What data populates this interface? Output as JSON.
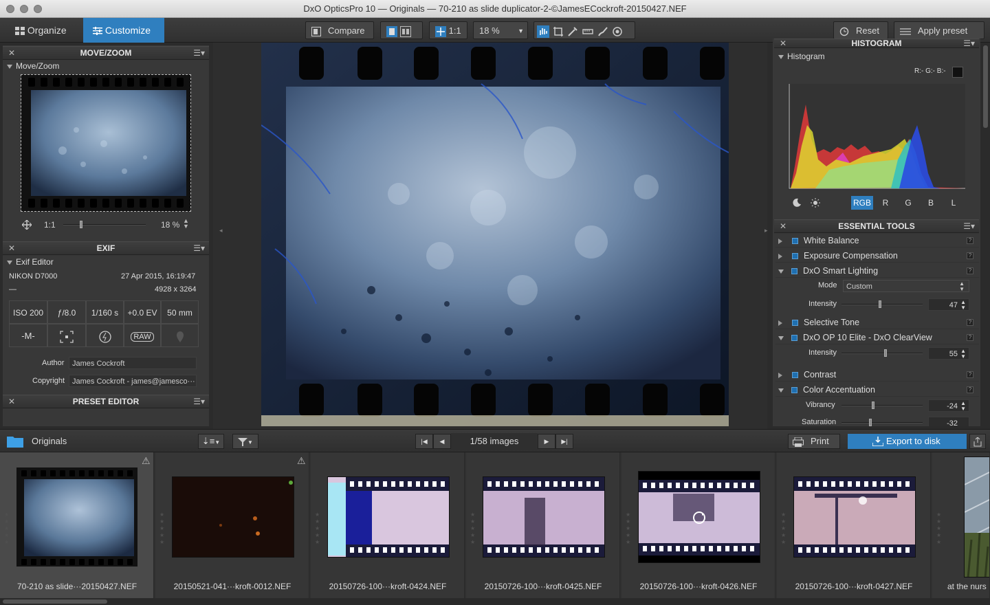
{
  "window": {
    "title": "DxO OpticsPro 10 — Originals — 70-210 as slide duplicator-2-©JamesECockroft-20150427.NEF"
  },
  "tabs": [
    {
      "label": "Organize"
    },
    {
      "label": "Customize"
    }
  ],
  "toolbar": {
    "compare_label": "Compare",
    "ratio_label": "1:1",
    "zoom_value": "18 %",
    "reset_label": "Reset",
    "apply_preset_label": "Apply preset"
  },
  "movezoom": {
    "header": "MOVE/ZOOM",
    "sub": "Move/Zoom",
    "ratio": "1:1",
    "zoom": "18 %"
  },
  "exif": {
    "header": "EXIF",
    "sub": "Exif Editor",
    "camera": "NIKON D7000",
    "date": "27 Apr 2015, 16:19:47",
    "lens": "—",
    "dimensions": "4928 x 3264",
    "iso": "ISO 200",
    "aperture": "ƒ/8.0",
    "shutter": "1/160 s",
    "ev": "+0.0 EV",
    "focal": "50 mm",
    "mode": "-M-",
    "raw": "RAW",
    "author_label": "Author",
    "author": "James Cockroft",
    "copyright_label": "Copyright",
    "copyright": "James Cockroft - james@jamesco···"
  },
  "preset_editor": {
    "header": "PRESET EDITOR"
  },
  "histogram": {
    "header": "HISTOGRAM",
    "sub": "Histogram",
    "readout": "R:- G:- B:-",
    "channels": [
      "RGB",
      "R",
      "G",
      "B",
      "L"
    ],
    "active_channel": "RGB"
  },
  "essential": {
    "header": "ESSENTIAL TOOLS",
    "tools": [
      {
        "label": "White Balance",
        "expanded": false
      },
      {
        "label": "Exposure Compensation",
        "expanded": false
      },
      {
        "label": "DxO Smart Lighting",
        "expanded": true
      },
      {
        "label": "Selective Tone",
        "expanded": false
      },
      {
        "label": "DxO OP 10 Elite - DxO ClearView",
        "expanded": true
      },
      {
        "label": "Contrast",
        "expanded": false
      },
      {
        "label": "Color Accentuation",
        "expanded": true
      }
    ],
    "smart_lighting": {
      "mode_label": "Mode",
      "mode_value": "Custom",
      "intensity_label": "Intensity",
      "intensity": "47"
    },
    "clearview": {
      "intensity_label": "Intensity",
      "intensity": "55"
    },
    "color": {
      "vibrancy_label": "Vibrancy",
      "vibrancy": "-24",
      "saturation_label": "Saturation",
      "saturation": "-32"
    }
  },
  "filmstrip": {
    "folder": "Originals",
    "counter": "1/58 images",
    "print_label": "Print",
    "export_label": "Export to disk",
    "items": [
      {
        "name": "70-210 as slide···20150427.NEF"
      },
      {
        "name": "20150521-041···kroft-0012.NEF"
      },
      {
        "name": "20150726-100···kroft-0424.NEF"
      },
      {
        "name": "20150726-100···kroft-0425.NEF"
      },
      {
        "name": "20150726-100···kroft-0426.NEF"
      },
      {
        "name": "20150726-100···kroft-0427.NEF"
      },
      {
        "name": "at the nurs"
      }
    ]
  },
  "icons": [
    "grid-icon",
    "sliders-icon",
    "compare-icon",
    "move-icon",
    "hand-icon",
    "crop-icon",
    "eyedropper-icon",
    "brush-icon",
    "reset-icon",
    "folder-icon",
    "sort-icon",
    "filter-icon",
    "print-icon",
    "export-icon",
    "share-icon"
  ],
  "colors": {
    "accent": "#2f7fbf",
    "panel": "#383838",
    "background": "#2b2b2b"
  }
}
